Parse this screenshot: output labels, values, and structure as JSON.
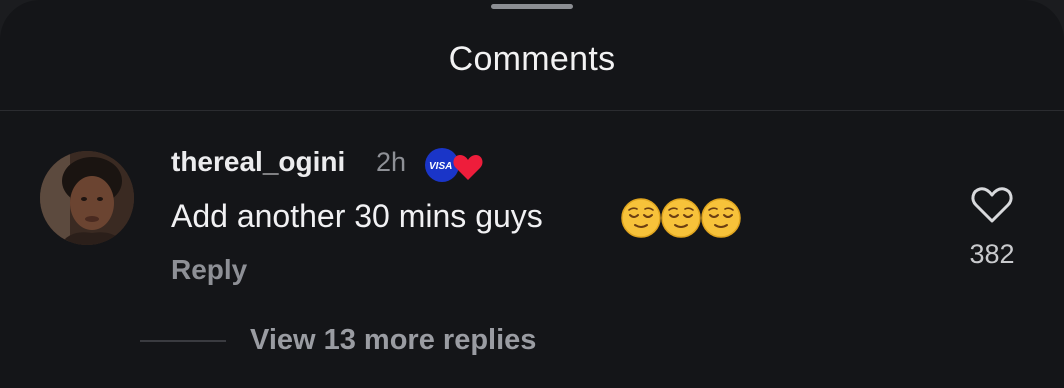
{
  "sheet": {
    "title": "Comments"
  },
  "comment": {
    "username": "thereal_ogini",
    "time": "2h",
    "badge_text": "VISA",
    "text": "Add another 30 mins guys",
    "emojis": [
      "relieved-face",
      "relieved-face",
      "relieved-face"
    ],
    "reply_label": "Reply",
    "like_count": "382",
    "view_replies_label": "View 13 more replies"
  },
  "colors": {
    "background": "#141518",
    "text_primary": "#f1f1f3",
    "text_secondary": "#8e9096",
    "badge_blue": "#1a35c8",
    "heart_red": "#ee1d3b",
    "emoji_yellow": "#f7c23a"
  },
  "icons": {
    "like": "heart-outline-icon",
    "badge": "visa-heart-badge-icon"
  }
}
